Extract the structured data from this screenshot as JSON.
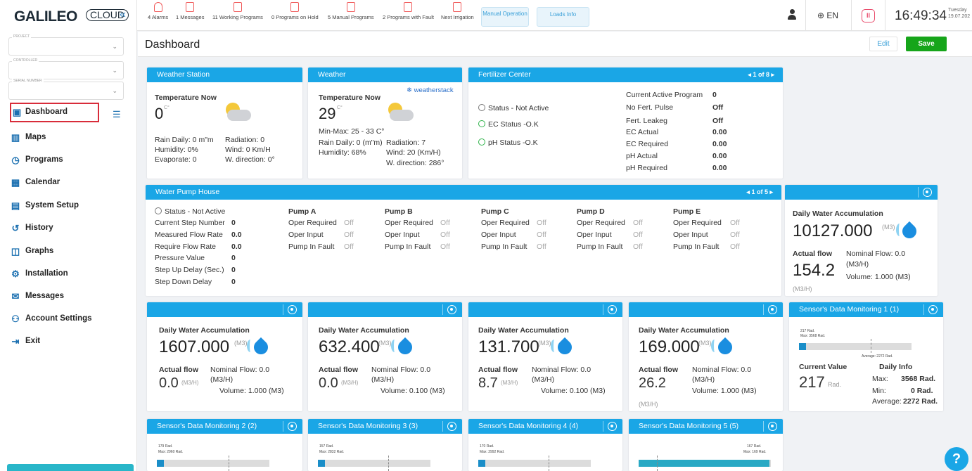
{
  "app": {
    "logo_brand": "GALILEO",
    "logo_cloud": "CLOUD",
    "collapse_symbol": "«"
  },
  "topbar": {
    "stats": [
      {
        "count": "4",
        "label": "Alarms"
      },
      {
        "count": "1",
        "label": "Messages"
      },
      {
        "count": "11",
        "label": "Working Programs"
      },
      {
        "count": "0",
        "label": "Programs on Hold"
      },
      {
        "count": "5",
        "label": "Manual Programs"
      },
      {
        "count": "2",
        "label": "Programs with Fault"
      },
      {
        "count": "",
        "label": "Next Irrigation"
      }
    ],
    "manual_operation": "Manual Operation",
    "loads_info": "Loads Info",
    "language": "EN",
    "time": "16:49:34",
    "day": "Tuesday",
    "date": "19.07.202"
  },
  "sidebar": {
    "project_label": "PROJECT",
    "controller_label": "CONTROLLER",
    "serial_label": "SERIAL NUMBER",
    "items": [
      {
        "label": "Dashboard"
      },
      {
        "label": "Maps"
      },
      {
        "label": "Programs"
      },
      {
        "label": "Calendar"
      },
      {
        "label": "System Setup"
      },
      {
        "label": "History"
      },
      {
        "label": "Graphs"
      },
      {
        "label": "Installation"
      },
      {
        "label": "Messages"
      },
      {
        "label": "Account Settings"
      },
      {
        "label": "Exit"
      }
    ]
  },
  "page": {
    "title": "Dashboard",
    "edit": "Edit",
    "save": "Save"
  },
  "weather_station": {
    "header": "Weather Station",
    "temp_label": "Temperature Now",
    "temp": "0",
    "unit": "C°",
    "rain": "Rain Daily: 0 m\"m",
    "humidity": "Humidity: 0%",
    "evaporate": "Evaporate: 0",
    "radiation": "Radiation: 0",
    "wind": "Wind: 0 Km/H",
    "wdir": "W. direction: 0°"
  },
  "weather": {
    "header": "Weather",
    "provider": "weatherstack",
    "temp_label": "Temperature Now",
    "temp": "29",
    "unit": "C°",
    "minmax": "Min-Max: 25 - 33 C°",
    "rain": "Rain Daily: 0 (m\"m)",
    "humidity": "Humidity: 68%",
    "radiation": "Radiation: 7",
    "wind": "Wind: 20 (Km/H)",
    "wdir": "W. direction: 286°"
  },
  "fertilizer": {
    "header": "Fertilizer Center",
    "pager": "1 of 8",
    "status": "Status - Not Active",
    "ec_status": "EC Status -O.K",
    "ph_status": "pH Status -O.K",
    "rows": [
      {
        "label": "Current Active Program",
        "value": "0"
      },
      {
        "label": "No Fert. Pulse",
        "value": "Off"
      },
      {
        "label": "Fert. Leakeg",
        "value": "Off"
      },
      {
        "label": "EC Actual",
        "value": "0.00"
      },
      {
        "label": "EC Required",
        "value": "0.00"
      },
      {
        "label": "pH Actual",
        "value": "0.00"
      },
      {
        "label": "pH Required",
        "value": "0.00"
      }
    ]
  },
  "pump_house": {
    "header": "Water Pump House",
    "pager": "1 of 5",
    "status": "Status - Not Active",
    "rows": [
      {
        "label": "Current Step Number",
        "value": "0"
      },
      {
        "label": "Measured Flow Rate",
        "value": "0.0"
      },
      {
        "label": "Require Flow Rate",
        "value": "0.0"
      },
      {
        "label": "Pressure Value",
        "value": "0"
      },
      {
        "label": "Step Up Delay (Sec.)",
        "value": "0"
      },
      {
        "label": "Step Down Delay",
        "value": "0"
      }
    ],
    "pumps": [
      {
        "name": "Pump A",
        "oper_required": "Off",
        "oper_input": "Off",
        "fault": "Off"
      },
      {
        "name": "Pump B",
        "oper_required": "Off",
        "oper_input": "Off",
        "fault": "Off"
      },
      {
        "name": "Pump C",
        "oper_required": "Off",
        "oper_input": "Off",
        "fault": "Off"
      },
      {
        "name": "Pump D",
        "oper_required": "Off",
        "oper_input": "Off",
        "fault": "Off"
      },
      {
        "name": "Pump E",
        "oper_required": "Off",
        "oper_input": "Off",
        "fault": "Off"
      }
    ],
    "labels": {
      "oper_required": "Oper Required",
      "oper_input": "Oper Input",
      "fault": "Pump In Fault"
    }
  },
  "water_labels": {
    "daily": "Daily Water Accumulation",
    "m3": "(M3)",
    "actual": "Actual flow",
    "nominal": "Nominal Flow: 0.0",
    "m3h": "(M3/H)"
  },
  "water_meters": [
    {
      "accum": "10127.000",
      "flow": "154.2",
      "volume": "Volume: 1.000 (M3)"
    },
    {
      "accum": "1607.000",
      "flow": "0.0",
      "volume": "Volume: 1.000 (M3)"
    },
    {
      "accum": "632.400",
      "flow": "0.0",
      "volume": "Volume: 0.100 (M3)"
    },
    {
      "accum": "131.700",
      "flow": "8.7",
      "volume": "Volume: 0.100 (M3)"
    },
    {
      "accum": "169.000",
      "flow": "26.2",
      "volume": "Volume: 1.000 (M3)"
    }
  ],
  "sensor1": {
    "header": "Sensor's Data Monitoring 1 (1)",
    "small_value": "217 Rad.",
    "small_max": "Max: 3568 Rad.",
    "small_avg": "Average: 2272 Rad.",
    "current_label": "Current Value",
    "current": "217",
    "unit": "Rad.",
    "daily_label": "Daily Info",
    "max_label": "Max:",
    "max": "3568 Rad.",
    "min_label": "Min:",
    "min": "0 Rad.",
    "avg_label": "Average:",
    "avg": "2272 Rad.",
    "fill": 0.06
  },
  "sensors": [
    {
      "header": "Sensor's Data Monitoring 2 (2)",
      "value": "179 Rad.",
      "max": "Max: 2960 Rad.",
      "fill": 0.06
    },
    {
      "header": "Sensor's Data Monitoring 3 (3)",
      "value": "157 Rad.",
      "max": "Max: 2832 Rad.",
      "fill": 0.06
    },
    {
      "header": "Sensor's Data Monitoring 4 (4)",
      "value": "170 Rad.",
      "max": "Max: 2992 Rad.",
      "fill": 0.06
    },
    {
      "header": "Sensor's Data Monitoring 5 (5)",
      "value": "167 Rad.",
      "max": "Max: 169 Rad.",
      "fill": 0.99
    }
  ],
  "help": "?"
}
